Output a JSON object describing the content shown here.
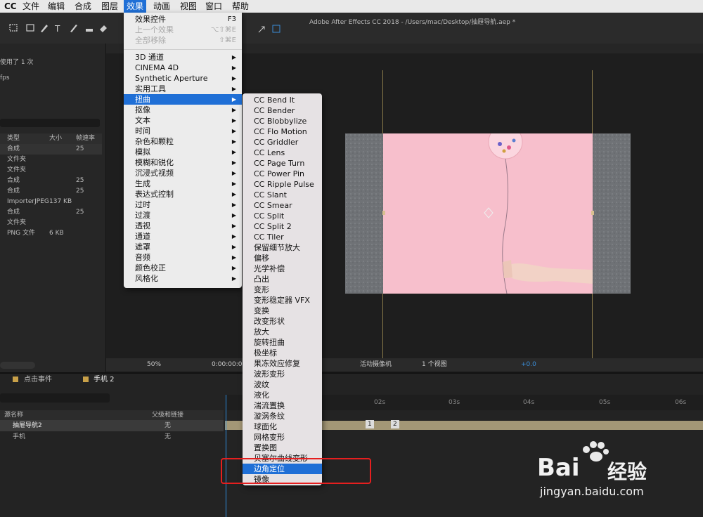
{
  "menubar": {
    "app": "CC",
    "items": [
      "文件",
      "编辑",
      "合成",
      "图层",
      "效果",
      "动画",
      "视图",
      "窗口",
      "帮助"
    ],
    "active": "效果"
  },
  "window_title": "Adobe After Effects CC 2018 - /Users/mac/Desktop/抽屉导航.aep *",
  "project": {
    "used_text": "使用了 1 次",
    "fps_text": "fps",
    "columns": [
      "类型",
      "大小",
      "帧速率"
    ],
    "rows": [
      {
        "type": "合成",
        "size": "",
        "fps": "25"
      },
      {
        "type": "文件夹",
        "size": "",
        "fps": ""
      },
      {
        "type": "文件夹",
        "size": "",
        "fps": ""
      },
      {
        "type": "合成",
        "size": "",
        "fps": "25"
      },
      {
        "type": "合成",
        "size": "",
        "fps": "25"
      },
      {
        "type": "ImporterJPEG",
        "size": "137 KB",
        "fps": ""
      },
      {
        "type": "合成",
        "size": "",
        "fps": "25"
      },
      {
        "type": "文件夹",
        "size": "",
        "fps": ""
      },
      {
        "type": "PNG 文件",
        "size": "6 KB",
        "fps": ""
      }
    ]
  },
  "viewer_bar": {
    "zoom": "50%",
    "timecode": "0:00:00:00",
    "camera": "活动摄像机",
    "views": "1 个视图",
    "exposure": "+0.0"
  },
  "timeline": {
    "tabs": [
      "点击事件",
      "手机 2"
    ],
    "columns": [
      "源名称",
      "父级和链接"
    ],
    "ruler": [
      "02s",
      "03s",
      "04s",
      "05s",
      "06s"
    ],
    "layers": [
      {
        "name": "抽屉导航2",
        "parent": "无"
      },
      {
        "name": "手机",
        "parent": "无"
      }
    ],
    "keyframes": [
      "1",
      "2"
    ]
  },
  "effects_menu": {
    "top_items": [
      {
        "label": "效果控件",
        "shortcut": "F3",
        "disabled": false
      },
      {
        "label": "上一个效果",
        "shortcut": "⌥⇧⌘E",
        "disabled": true
      },
      {
        "label": "全部移除",
        "shortcut": "⇧⌘E",
        "disabled": true
      }
    ],
    "categories": [
      "3D 通道",
      "CINEMA 4D",
      "Synthetic Aperture",
      "实用工具",
      "扭曲",
      "抠像",
      "文本",
      "时间",
      "杂色和颗粒",
      "模拟",
      "模糊和锐化",
      "沉浸式视频",
      "生成",
      "表达式控制",
      "过时",
      "过渡",
      "透视",
      "通道",
      "遮罩",
      "音频",
      "颜色校正",
      "风格化"
    ],
    "highlighted": "扭曲"
  },
  "distort_submenu": {
    "items": [
      "CC Bend It",
      "CC Bender",
      "CC Blobbylize",
      "CC Flo Motion",
      "CC Griddler",
      "CC Lens",
      "CC Page Turn",
      "CC Power Pin",
      "CC Ripple Pulse",
      "CC Slant",
      "CC Smear",
      "CC Split",
      "CC Split 2",
      "CC Tiler",
      "保留细节放大",
      "偏移",
      "光学补偿",
      "凸出",
      "变形",
      "变形稳定器 VFX",
      "变换",
      "改变形状",
      "放大",
      "旋转扭曲",
      "极坐标",
      "果冻效应修复",
      "波形变形",
      "波纹",
      "液化",
      "湍流置换",
      "漩涡条纹",
      "球面化",
      "网格变形",
      "置换图",
      "贝塞尔曲线变形",
      "边角定位",
      "镜像"
    ],
    "highlighted": "边角定位"
  },
  "watermark": {
    "brand": "Bai",
    "brand2": "经验",
    "url": "jingyan.baidu.com"
  },
  "colors": {
    "menu_highlight": "#1f6fd6",
    "annotation_box": "#e51f1f",
    "comp_background": "#f7bfcc"
  }
}
